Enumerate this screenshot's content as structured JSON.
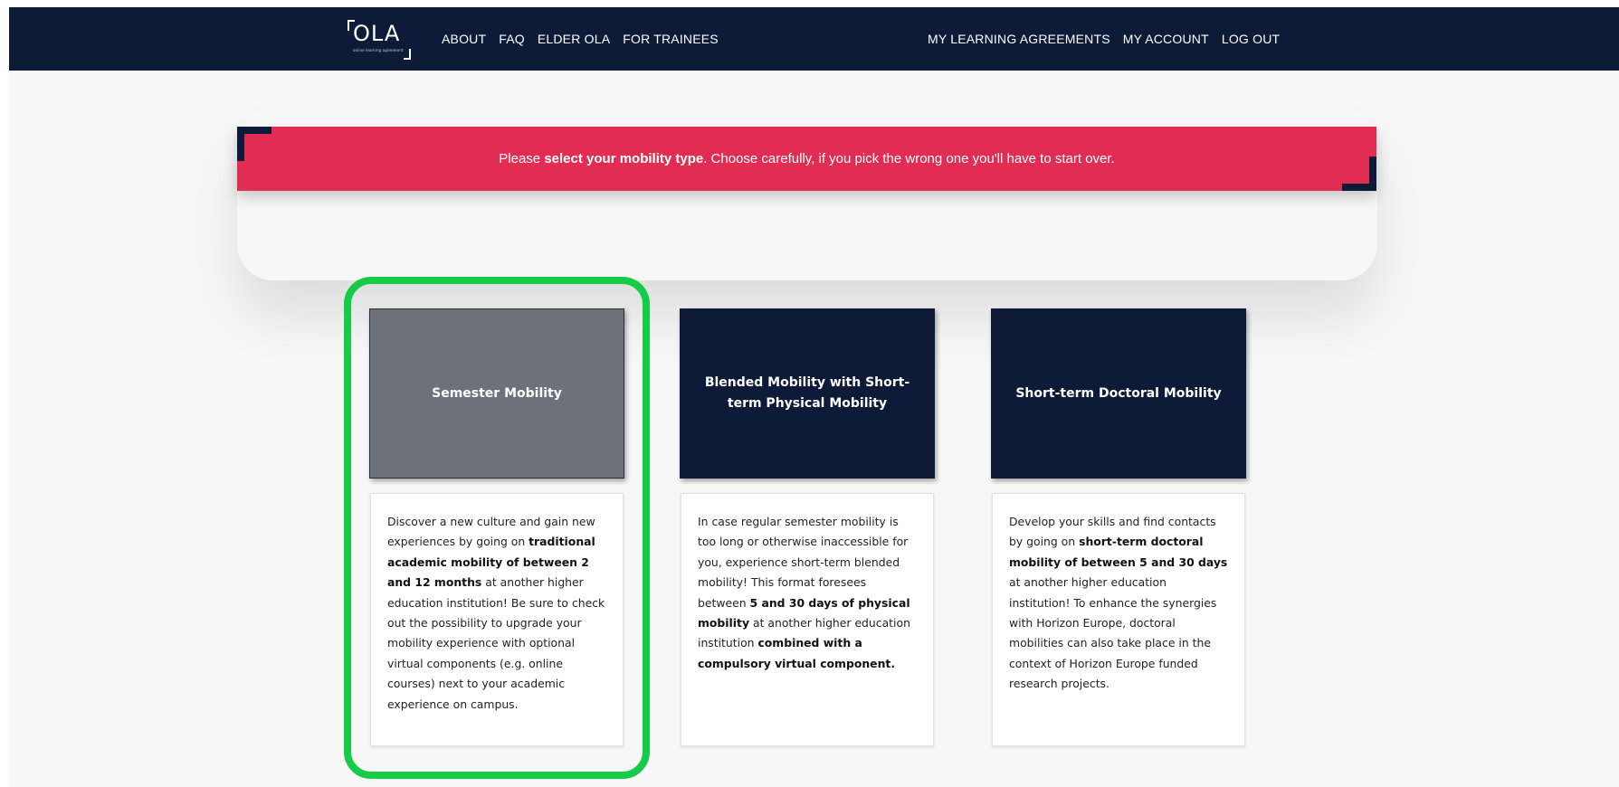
{
  "logo": {
    "text": "OLA",
    "tagline": "online learning agreement"
  },
  "nav": {
    "left": [
      "ABOUT",
      "FAQ",
      "ELDER OLA",
      "FOR TRAINEES"
    ],
    "right": [
      "MY LEARNING AGREEMENTS",
      "MY ACCOUNT",
      "LOG OUT"
    ]
  },
  "banner": {
    "prefix": "Please ",
    "bold": "select your mobility type",
    "suffix": ". Choose carefully, if you pick the wrong one you'll have to start over."
  },
  "cards": [
    {
      "title": "Semester Mobility",
      "selected": true,
      "desc": [
        {
          "t": "Discover a new culture and gain new experiences by going on ",
          "b": false
        },
        {
          "t": "traditional academic mobility of between 2 and 12 months",
          "b": true
        },
        {
          "t": " at another higher education institution! Be sure to check out the possibility to upgrade your mobility experience with optional virtual components (e.g. online courses) next to your academic experience on campus.",
          "b": false
        }
      ]
    },
    {
      "title": "Blended Mobility with Short-term Physical Mobility",
      "selected": false,
      "desc": [
        {
          "t": "In case regular semester mobility is too long or otherwise inaccessible for you, experience short-term blended mobility! This format foresees between ",
          "b": false
        },
        {
          "t": "5 and 30 days of physical mobility",
          "b": true
        },
        {
          "t": " at another higher education institution ",
          "b": false
        },
        {
          "t": "combined with a compulsory virtual component.",
          "b": true
        }
      ]
    },
    {
      "title": "Short-term Doctoral Mobility",
      "selected": false,
      "desc": [
        {
          "t": "Develop your skills and find contacts by going on ",
          "b": false
        },
        {
          "t": "short-term doctoral mobility of between 5 and 30 days",
          "b": true
        },
        {
          "t": " at another higher education institution! To enhance the synergies with Horizon Europe, doctoral mobilities can also take place in the context of Horizon Europe funded research projects.",
          "b": false
        }
      ]
    }
  ],
  "colors": {
    "navy": "#0d1b38",
    "banner": "#e22d53",
    "selected": "#6b727a",
    "highlight": "#14cc48"
  }
}
